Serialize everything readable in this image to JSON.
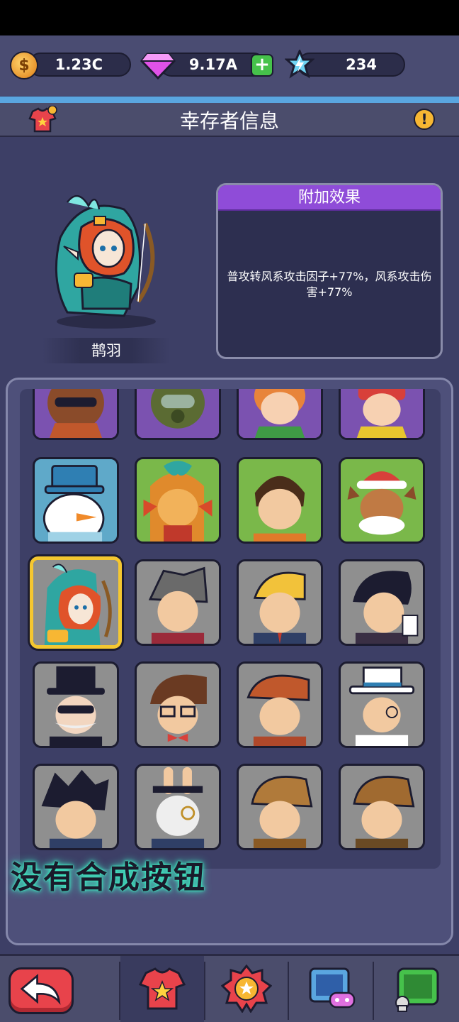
{
  "currency": {
    "coins": "1.23C",
    "gems": "9.17A",
    "energy": "234"
  },
  "header": {
    "title": "幸存者信息"
  },
  "hero": {
    "name": "鹊羽"
  },
  "effect": {
    "title": "附加效果",
    "description": "普攻转风系攻击因子+77%，风系攻击伤害+77%"
  },
  "caption": "没有合成按钮",
  "colors": {
    "accent_purple": "#8f4cd8",
    "selected_border": "#f4c730",
    "caption_glow": "#3ef0c4"
  }
}
